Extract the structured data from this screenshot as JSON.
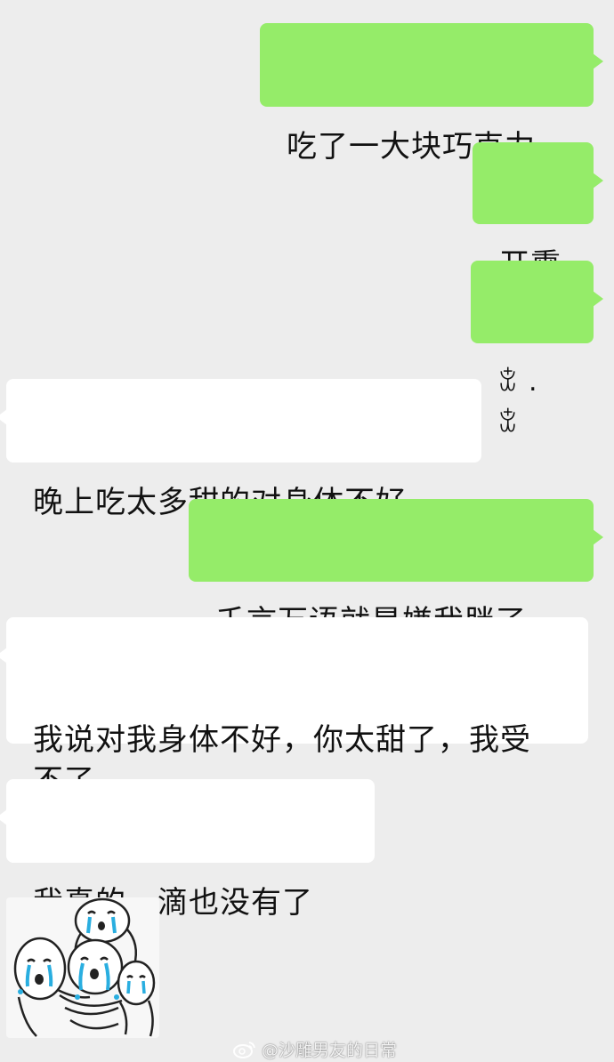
{
  "messages": [
    {
      "side": "sent",
      "text": "吃了一大块巧克力"
    },
    {
      "side": "sent",
      "text": "开熏"
    },
    {
      "side": "sent",
      "text": "ꒃ . ꒃ"
    },
    {
      "side": "received",
      "text": "晚上吃太多甜的对身体不好"
    },
    {
      "side": "sent",
      "text": "千言万语就是嫌我胖了"
    },
    {
      "side": "received",
      "text": "我说对我身体不好，你太甜了，我受不了"
    },
    {
      "side": "received",
      "text": "我真的一滴也没有了"
    }
  ],
  "sticker": {
    "type": "crying-hugging-cartoon-sticker"
  },
  "watermark": {
    "text": "@沙雕男友的日常",
    "icon": "weibo-icon"
  },
  "colors": {
    "background": "#ededed",
    "sent_bubble": "#95ec69",
    "received_bubble": "#ffffff"
  }
}
